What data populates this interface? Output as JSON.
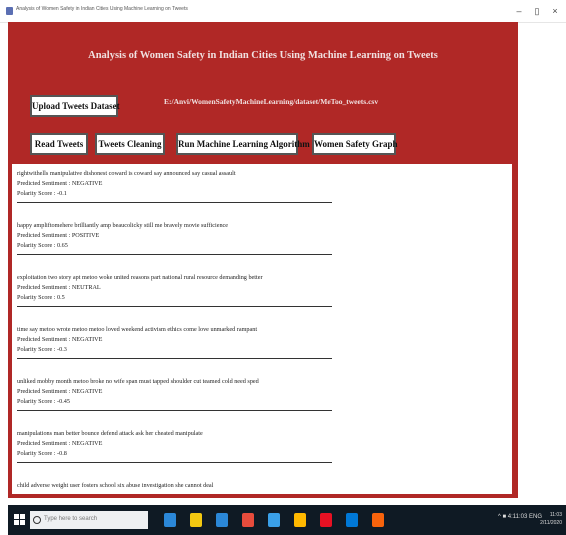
{
  "window": {
    "title": "Analysis of Women Safety in Indian Cities Using Machine Learning on Tweets",
    "buttons": [
      "–",
      "▯",
      "×"
    ]
  },
  "app": {
    "heading": "Analysis of Women Safety in Indian Cities Using Machine Learning on Tweets",
    "upload_label": "Upload Tweets Dataset",
    "path_text": "E:/Anvi/WomenSafetyMachineLearning/dataset/MeToo_tweets.csv",
    "buttons": {
      "read": "Read Tweets",
      "cleaning": "Tweets Cleaning",
      "run": "Run Machine Learning Algorithm",
      "graph": "Women Safety Graph"
    }
  },
  "results": [
    {
      "tweet": "rightwithells manipulative dishonest coward is coward say announced say casual assault",
      "sentiment": "Predicted Sentiment : NEGATIVE",
      "score": "Polarity Score : -0.1"
    },
    {
      "tweet": "happy ampliftomehere brilliantly amp beaucolicky still me bravely movie sufficience",
      "sentiment": "Predicted Sentiment : POSITIVE",
      "score": "Polarity Score : 0.65"
    },
    {
      "tweet": "exploitation two story apt metoo woke united reasons part national rural resource demanding better",
      "sentiment": "Predicted Sentiment : NEUTRAL",
      "score": "Polarity Score : 0.5"
    },
    {
      "tweet": "time say metoo wrote metoo metoo loved weekend activism ethics come love unmarked rampant",
      "sentiment": "Predicted Sentiment : NEGATIVE",
      "score": "Polarity Score : -0.3"
    },
    {
      "tweet": "unliked mobby month metoo broke no wife span must tapped shoulder cut teamed cold need sped",
      "sentiment": "Predicted Sentiment : NEGATIVE",
      "score": "Polarity Score : -0.45"
    },
    {
      "tweet": "manipulations man better bounce defend attack ask her cheated manipulate",
      "sentiment": "Predicted Sentiment : NEGATIVE",
      "score": "Polarity Score : -0.8"
    },
    {
      "tweet": "child adverse weight user fosters school six abuse investigation she cannot deal"
    }
  ],
  "taskbar": {
    "search_placeholder": "Type here to search",
    "tray": "^ ■ 4:11:03 ENG",
    "time": "11:03",
    "date": "2/11/2020",
    "app_colors": [
      "#2b88d8",
      "#f2c811",
      "#2b88d8",
      "#e74c3c",
      "#3aa0e8",
      "#ffb900",
      "#e81123",
      "#0078d7",
      "#f7630c"
    ]
  }
}
